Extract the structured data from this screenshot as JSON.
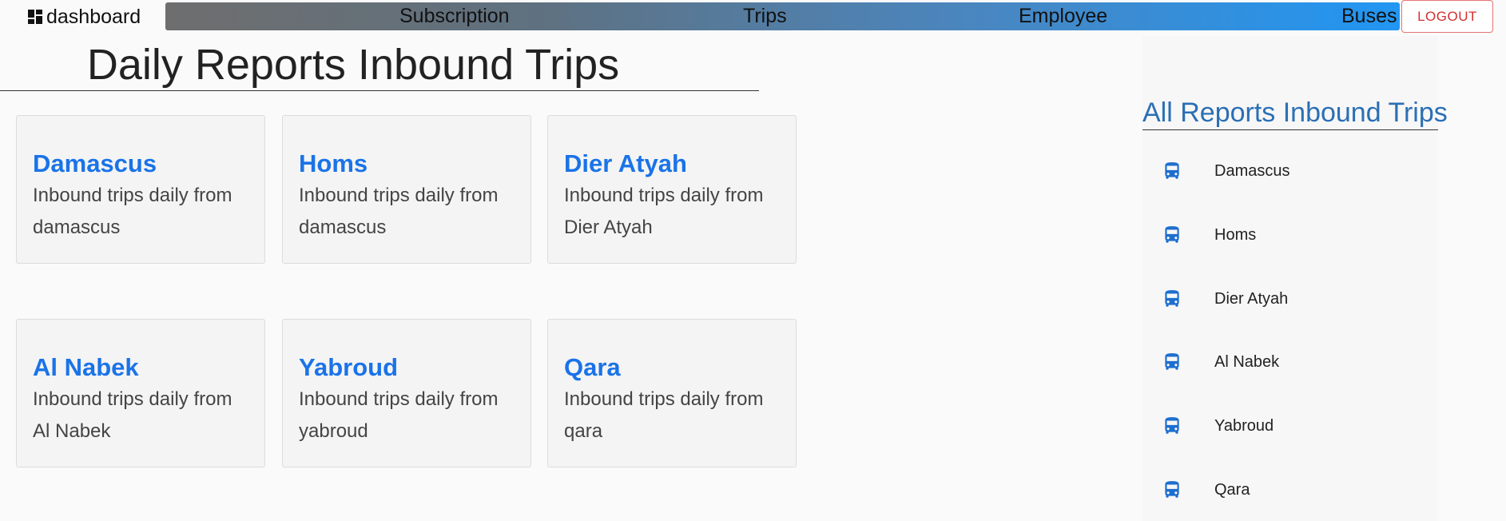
{
  "brand": {
    "label": "dashboard",
    "icon": "dashboard-icon"
  },
  "nav": {
    "subscription": "Subscription",
    "trips": "Trips",
    "employee": "Employee",
    "buses": "Buses",
    "logout": "LOGOUT"
  },
  "colors": {
    "accent": "#1a73e8",
    "logout": "#d32f2f",
    "nav_end": "#2196f3"
  },
  "page": {
    "title": "Daily Reports Inbound Trips"
  },
  "cards": [
    {
      "title": "Damascus",
      "desc": "Inbound trips daily from damascus"
    },
    {
      "title": "Homs",
      "desc": "Inbound trips daily from damascus"
    },
    {
      "title": "Dier Atyah",
      "desc": "Inbound trips daily from Dier Atyah"
    },
    {
      "title": "Al Nabek",
      "desc": "Inbound trips daily from Al Nabek"
    },
    {
      "title": "Yabroud",
      "desc": "Inbound trips daily from yabroud"
    },
    {
      "title": "Qara",
      "desc": "Inbound trips daily from qara"
    }
  ],
  "sidebar": {
    "title": "All Reports Inbound Trips",
    "icon": "bus-icon",
    "items": [
      {
        "label": "Damascus"
      },
      {
        "label": "Homs"
      },
      {
        "label": "Dier Atyah"
      },
      {
        "label": "Al Nabek"
      },
      {
        "label": "Yabroud"
      },
      {
        "label": "Qara"
      }
    ]
  }
}
